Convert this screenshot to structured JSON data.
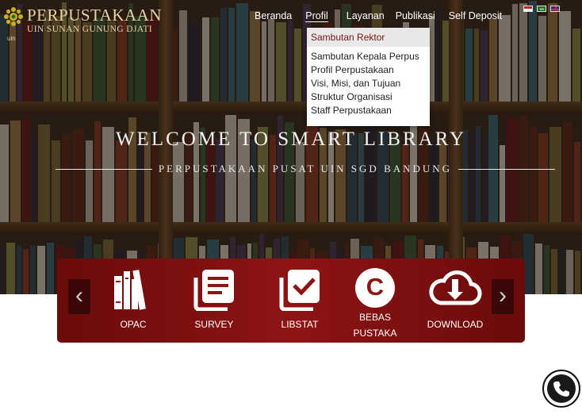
{
  "logo": {
    "title": "PERPUSTAKAAN",
    "subtitle": "UIN SUNAN GUNUNG DJATI",
    "small": "uin"
  },
  "nav": {
    "items": [
      "Beranda",
      "Profil",
      "Layanan",
      "Publikasi",
      "Self Deposit"
    ]
  },
  "flags": [
    "indonesia-flag",
    "saudi-flag",
    "uk-flag"
  ],
  "dropdown": {
    "items": [
      "Sambutan Rektor",
      "Sambutan Kepala Perpus",
      "Profil Perpustakaan",
      "Visi, Misi, dan Tujuan",
      "Struktur Organisasi",
      "Staff Perpustakaan"
    ]
  },
  "hero": {
    "title": "WELCOME TO SMART LIBRARY",
    "subtitle": "PERPUSTAKAAN PUSAT UIN SGD BANDUNG"
  },
  "services": {
    "prev": "‹",
    "next": "›",
    "items": [
      {
        "label": "OPAC",
        "icon": "books-icon"
      },
      {
        "label": "SURVEY",
        "icon": "document-list-icon"
      },
      {
        "label": "LIBSTAT",
        "icon": "checklist-icon"
      },
      {
        "label": "BEBAS PUSTAKA",
        "icon": "copyright-icon",
        "glyph": "C"
      },
      {
        "label": "DOWNLOAD",
        "icon": "cloud-download-icon"
      }
    ]
  },
  "colors": {
    "accent": "#8e1414",
    "dropdown_highlight": "#7a1414"
  }
}
